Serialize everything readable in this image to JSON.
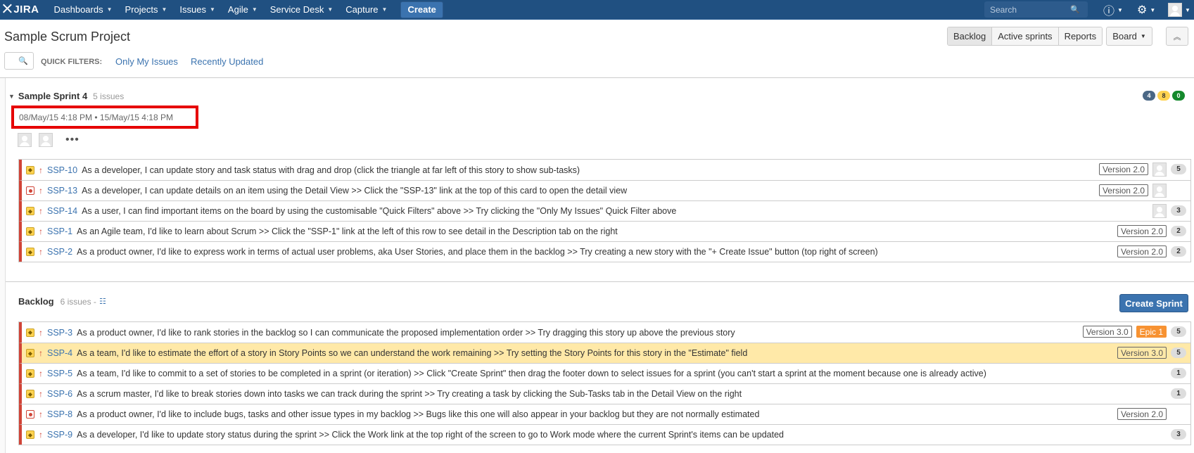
{
  "nav": {
    "logo": "JIRA",
    "items": [
      {
        "label": "Dashboards"
      },
      {
        "label": "Projects"
      },
      {
        "label": "Issues"
      },
      {
        "label": "Agile"
      },
      {
        "label": "Service Desk"
      },
      {
        "label": "Capture"
      }
    ],
    "create": "Create",
    "search_placeholder": "Search"
  },
  "header": {
    "title": "Sample Scrum Project",
    "views": [
      "Backlog",
      "Active sprints",
      "Reports"
    ],
    "board": "Board"
  },
  "quick_filters": {
    "label": "QUICK FILTERS:",
    "filters": [
      "Only My Issues",
      "Recently Updated"
    ]
  },
  "sprint": {
    "name": "Sample Sprint 4",
    "count": "5 issues",
    "dates": "08/May/15 4:18 PM  •   15/May/15 4:18 PM",
    "stats": [
      {
        "value": "4",
        "color": "#4a6785"
      },
      {
        "value": "8",
        "color": "#ffd351"
      },
      {
        "value": "0",
        "color": "#14892c"
      }
    ],
    "issues": [
      {
        "type": "story",
        "key": "SSP-10",
        "summary": "As a developer, I can update story and task status with drag and drop (click the triangle at far left of this story to show sub-tasks)",
        "version": "Version 2.0",
        "avatar": true,
        "points": "5"
      },
      {
        "type": "bug",
        "key": "SSP-13",
        "summary": "As a developer, I can update details on an item using the Detail View >> Click the \"SSP-13\" link at the top of this card to open the detail view",
        "version": "Version 2.0",
        "avatar": true,
        "points": ""
      },
      {
        "type": "story",
        "key": "SSP-14",
        "summary": "As a user, I can find important items on the board by using the customisable \"Quick Filters\" above >> Try clicking the \"Only My Issues\" Quick Filter above",
        "version": "",
        "avatar": true,
        "points": "3"
      },
      {
        "type": "story",
        "key": "SSP-1",
        "summary": "As an Agile team, I'd like to learn about Scrum >> Click the \"SSP-1\" link at the left of this row to see detail in the Description tab on the right",
        "version": "Version 2.0",
        "avatar": false,
        "points": "2"
      },
      {
        "type": "story",
        "key": "SSP-2",
        "summary": "As a product owner, I'd like to express work in terms of actual user problems, aka User Stories, and place them in the backlog >> Try creating a new story with the \"+ Create Issue\" button (top right of screen)",
        "version": "Version 2.0",
        "avatar": false,
        "points": "2"
      }
    ]
  },
  "backlog": {
    "title": "Backlog",
    "count": "6 issues -",
    "create_sprint": "Create Sprint",
    "issues": [
      {
        "type": "story",
        "key": "SSP-3",
        "summary": "As a product owner, I'd like to rank stories in the backlog so I can communicate the proposed implementation order >> Try dragging this story up above the previous story",
        "version": "Version 3.0",
        "epic": "Epic 1",
        "points": "5",
        "selected": false
      },
      {
        "type": "story",
        "key": "SSP-4",
        "summary": "As a team, I'd like to estimate the effort of a story in Story Points so we can understand the work remaining >> Try setting the Story Points for this story in the \"Estimate\" field",
        "version": "Version 3.0",
        "epic": "",
        "points": "5",
        "selected": true
      },
      {
        "type": "story",
        "key": "SSP-5",
        "summary": "As a team, I'd like to commit to a set of stories to be completed in a sprint (or iteration) >> Click \"Create Sprint\" then drag the footer down to select issues for a sprint (you can't start a sprint at the moment because one is already active)",
        "version": "",
        "epic": "",
        "points": "1",
        "selected": false
      },
      {
        "type": "story",
        "key": "SSP-6",
        "summary": "As a scrum master, I'd like to break stories down into tasks we can track during the sprint >> Try creating a task by clicking the Sub-Tasks tab in the Detail View on the right",
        "version": "",
        "epic": "",
        "points": "1",
        "selected": false
      },
      {
        "type": "bug",
        "key": "SSP-8",
        "summary": "As a product owner, I'd like to include bugs, tasks and other issue types in my backlog >> Bugs like this one will also appear in your backlog but they are not normally estimated",
        "version": "Version 2.0",
        "epic": "",
        "points": "",
        "selected": false
      },
      {
        "type": "story",
        "key": "SSP-9",
        "summary": "As a developer, I'd like to update story status during the sprint >> Click the Work link at the top right of the screen to go to Work mode where the current Sprint's items can be updated",
        "version": "",
        "epic": "",
        "points": "3",
        "selected": false
      }
    ]
  }
}
